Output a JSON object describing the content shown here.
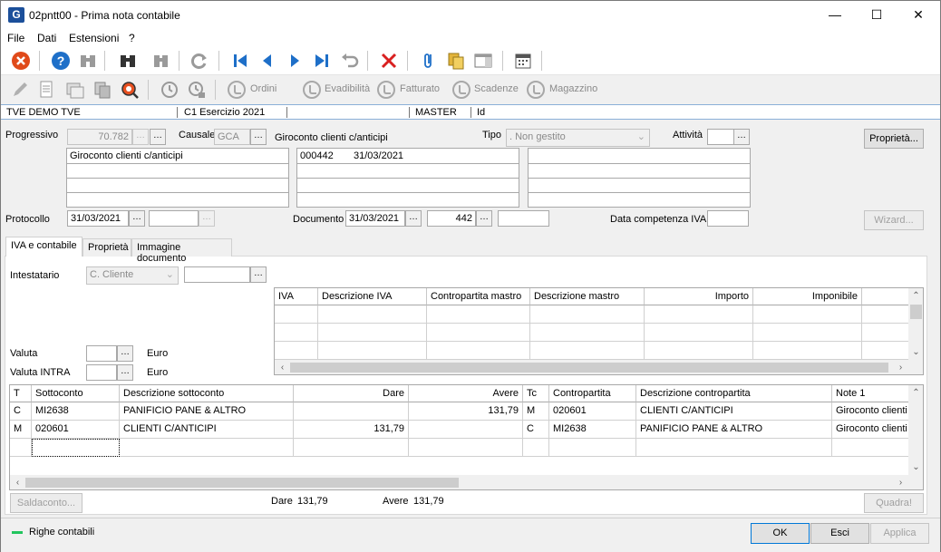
{
  "window": {
    "title": "02pntt00 - Prima nota contabile",
    "logo": "G",
    "controls": {
      "minimize": "—",
      "maximize": "☐",
      "close": "✕"
    }
  },
  "menu": [
    "File",
    "Dati",
    "Estensioni",
    "?"
  ],
  "toolbar2": {
    "ordini": "Ordini",
    "evadibilita": "Evadibilità",
    "fatturato": "Fatturato",
    "scadenze": "Scadenze",
    "magazzino": "Magazzino"
  },
  "infobar": {
    "company": "TVE DEMO TVE",
    "year": "C1 Esercizio 2021",
    "user": "MASTER",
    "id": "Id"
  },
  "header": {
    "progressivo_label": "Progressivo",
    "progressivo_value": "70.782",
    "causale_label": "Causale",
    "causale_value": "GCA",
    "causale_desc": "Giroconto clienti c/anticipi",
    "tipo_label": "Tipo",
    "tipo_value": ". Non gestito",
    "attivita_label": "Attività",
    "proprieta_button": "Proprietà...",
    "desc_box1": [
      "Giroconto clienti c/anticipi",
      "",
      "",
      ""
    ],
    "desc_box2_num": "000442",
    "desc_box2_date": "31/03/2021",
    "protocollo_label": "Protocollo",
    "protocollo_date": "31/03/2021",
    "documento_label": "Documento",
    "documento_date": "31/03/2021",
    "documento_num": "442",
    "data_competenza_label": "Data competenza IVA",
    "wizard_button": "Wizard..."
  },
  "tabs": [
    "IVA e contabile",
    "Proprietà",
    "Immagine documento"
  ],
  "iva": {
    "intestatario_label": "Intestatario",
    "intestatario_value": "C. Cliente",
    "valuta_label": "Valuta",
    "valuta_currency": "Euro",
    "valuta_intra_label": "Valuta INTRA",
    "valuta_intra_currency": "Euro",
    "columns": [
      "IVA",
      "Descrizione IVA",
      "Contropartita mastro",
      "Descrizione mastro",
      "Importo",
      "Imponibile"
    ]
  },
  "ledger": {
    "columns": [
      "T",
      "Sottoconto",
      "Descrizione sottoconto",
      "Dare",
      "Avere",
      "Tc",
      "Contropartita",
      "Descrizione contropartita",
      "Note 1"
    ],
    "rows": [
      {
        "t": "C",
        "sottoconto": "MI2638",
        "descr": "PANIFICIO PANE & ALTRO",
        "dare": "",
        "avere": "131,79",
        "tc": "M",
        "contro": "020601",
        "contro_descr": "CLIENTI C/ANTICIPI",
        "note": "Giroconto clienti"
      },
      {
        "t": "M",
        "sottoconto": "020601",
        "descr": "CLIENTI C/ANTICIPI",
        "dare": "131,79",
        "avere": "",
        "tc": "C",
        "contro": "MI2638",
        "contro_descr": "PANIFICIO PANE & ALTRO",
        "note": "Giroconto clienti"
      }
    ]
  },
  "totals": {
    "saldaconto_button": "Saldaconto...",
    "dare_label": "Dare",
    "dare_value": "131,79",
    "avere_label": "Avere",
    "avere_value": "131,79",
    "quadra_button": "Quadra!"
  },
  "footer": {
    "legend": "Righe contabili",
    "legend_color": "#22c55e",
    "ok_button": "OK",
    "esci_button": "Esci",
    "applica_button": "Applica"
  }
}
